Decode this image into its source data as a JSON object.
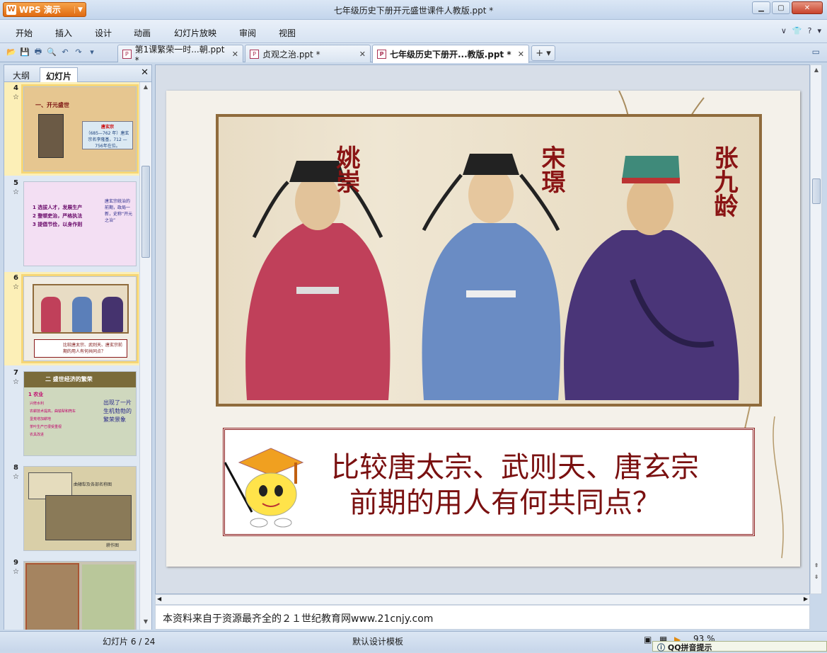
{
  "app": {
    "name": "WPS 演示",
    "window_title": "七年级历史下册开元盛世课件人教版.ppt *"
  },
  "menu": [
    "开始",
    "插入",
    "设计",
    "动画",
    "幻灯片放映",
    "审阅",
    "视图"
  ],
  "tabs": [
    {
      "label": "第1课繁荣一时...朝.ppt *",
      "active": false
    },
    {
      "label": "贞观之治.ppt *",
      "active": false
    },
    {
      "label": "七年级历史下册开...教版.ppt *",
      "active": true
    }
  ],
  "panel": {
    "tab_outline": "大纲",
    "tab_slides": "幻灯片"
  },
  "thumbnails": [
    {
      "num": "4",
      "title": "一、开元盛世",
      "caption": "唐玄宗",
      "sub": "（685—762 年）唐玄宗名李隆基，712 — 756年在位。"
    },
    {
      "num": "5",
      "lines": [
        "1 选拔人才，发展生产",
        "2 整顿吏治，严格执法",
        "3 提倡节俭，以身作则"
      ],
      "side": "唐玄宗统治的前期，政局一新，史称“开元之治”"
    },
    {
      "num": "6",
      "names": [
        "姚崇",
        "宋璟",
        "张九龄"
      ],
      "caption": "比较唐太宗、武则天、唐玄宗前期的用人有何共同点？"
    },
    {
      "num": "7",
      "title": "二 盛世经济的繁荣",
      "sub": "1 农业",
      "lines": [
        "兴修水利",
        "农耕技术提高，曲辕犁和筒车",
        "垦荒增加耕地",
        "茶叶生产已很受重视",
        "农具改进"
      ],
      "side": "出现了一片生机勃勃的繁荣景象"
    },
    {
      "num": "8",
      "label1": "曲辕犁及各部名称图",
      "label2": "耕作图"
    },
    {
      "num": "9"
    }
  ],
  "slide": {
    "names": [
      "姚崇",
      "宋璟",
      "张九龄"
    ],
    "question_line1": "比较唐太宗、武则天、唐玄宗",
    "question_line2": "前期的用人有何共同点？"
  },
  "notes": "本资料来自于资源最齐全的２１世纪教育网www.21cnjy.com",
  "status": {
    "slide": "幻灯片 6 / 24",
    "template": "默认设计模板",
    "zoom": "93 %",
    "popup": "QQ拼音提示"
  },
  "colors": {
    "title_red": "#7a1010",
    "frame_brown": "#8f6b3c"
  }
}
